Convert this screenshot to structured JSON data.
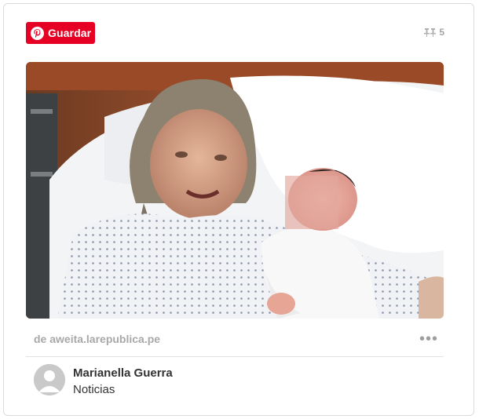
{
  "save_button": {
    "label": "Guardar",
    "icon": "pinterest-logo-icon",
    "color": "#e60023"
  },
  "repin": {
    "icon": "pin-icon",
    "count": "5"
  },
  "image": {
    "description_icon": "photo-image"
  },
  "source": {
    "text": "de aweita.larepublica.pe"
  },
  "more_menu": {
    "label": "•••",
    "icon": "more-dots-icon"
  },
  "pinner": {
    "name": "Marianella Guerra",
    "board": "Noticias",
    "avatar_icon": "default-avatar-icon"
  }
}
